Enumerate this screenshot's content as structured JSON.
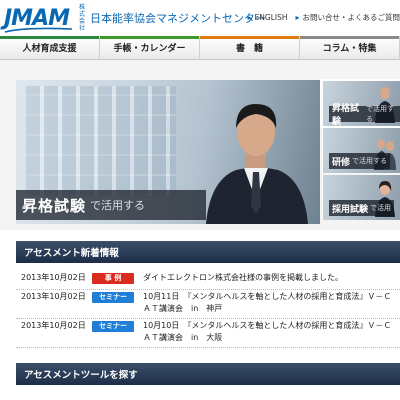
{
  "header": {
    "logo_text": "JMAM",
    "logo_corp_label": "株式会社",
    "logo_name": "日本能率協会マネジメントセンター",
    "utility_links": [
      {
        "label": "ENGLISH"
      },
      {
        "label": "お問い合せ・よくあるご質問"
      }
    ]
  },
  "nav": {
    "tabs": [
      {
        "label": "人材育成支援",
        "color": "#2a8a3c"
      },
      {
        "label": "手帳・カレンダー",
        "color": "#3a9a2a"
      },
      {
        "label": "書　籍",
        "color": "#e07a12"
      },
      {
        "label": "コラム・特集",
        "color": "#8a8a8a"
      }
    ]
  },
  "hero": {
    "main_caption_strong": "昇格試験",
    "main_caption_light": "で活用する",
    "side_tiles": [
      {
        "strong": "昇格試験",
        "light": "で活用する"
      },
      {
        "strong": "研修",
        "light": "で活用する"
      },
      {
        "strong": "採用試験",
        "light": "で活用"
      }
    ]
  },
  "news": {
    "heading": "アセスメント新着情報",
    "items": [
      {
        "date": "2013年10月02日",
        "badge": "事 例",
        "badge_color": "#d92b1e",
        "text": "ダイトエレクトロン株式会社様の事例を掲載しました。"
      },
      {
        "date": "2013年10月02日",
        "badge": "セミナー",
        "badge_color": "#1f7fd6",
        "text": "10月11日　『メンタルヘルスを軸とした人材の採用と育成法』Ｖ－ＣＡＴ講演会　in　神戸"
      },
      {
        "date": "2013年10月02日",
        "badge": "セミナー",
        "badge_color": "#1f7fd6",
        "text": "10月10日　『メンタルヘルスを軸とした人材の採用と育成法』Ｖ－ＣＡＴ講演会　in　大阪"
      }
    ]
  },
  "tools": {
    "heading": "アセスメントツールを探す"
  },
  "colors": {
    "brand": "#0a67b2",
    "section_header": "#1d2d47"
  }
}
